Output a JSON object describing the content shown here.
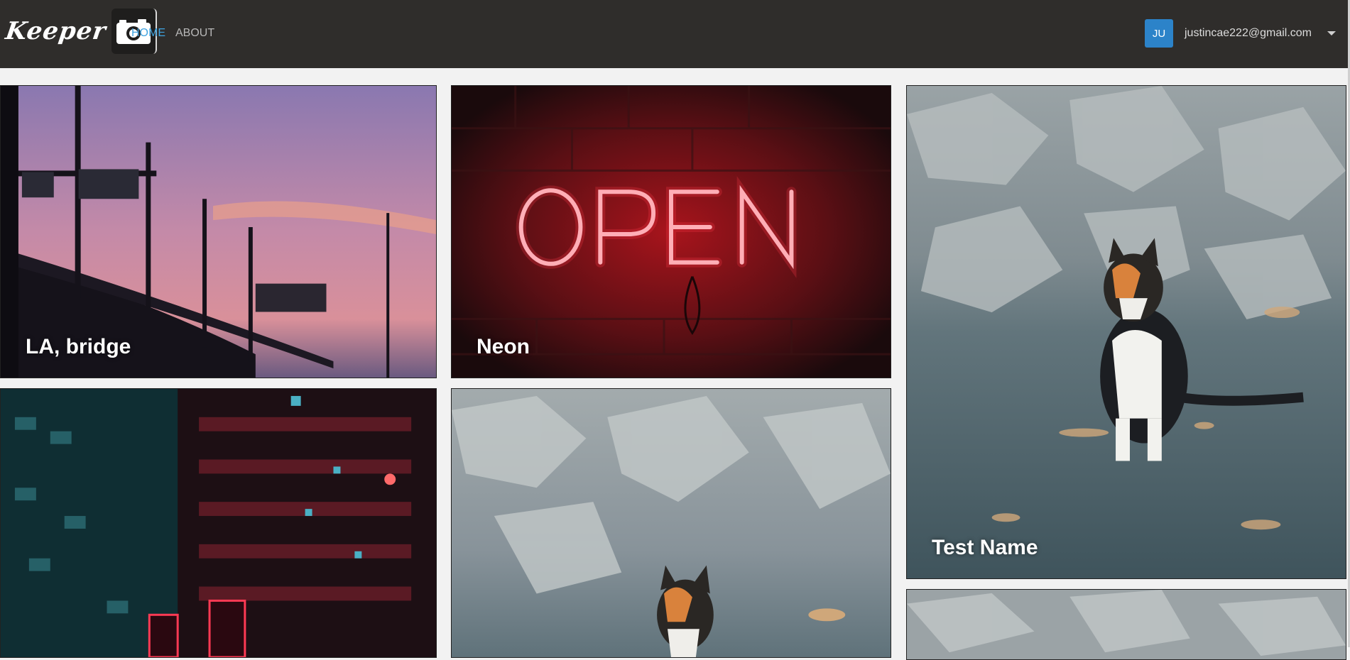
{
  "brand": {
    "name": "Keeper",
    "logo_icon": "camera-icon"
  },
  "nav": {
    "items": [
      {
        "label": "HOME",
        "active": true
      },
      {
        "label": "ABOUT",
        "active": false
      }
    ]
  },
  "user": {
    "initials": "JU",
    "email": "justincae222@gmail.com",
    "dropdown_icon": "caret-down-icon"
  },
  "colors": {
    "navbar": "#2f2d2b",
    "accent": "#3fa3e0",
    "avatar": "#2c83c9"
  },
  "gallery": {
    "items": [
      {
        "title": "LA, bridge"
      },
      {
        "title": "Neon"
      },
      {
        "title": "Test Name"
      },
      {
        "title": ""
      },
      {
        "title": ""
      },
      {
        "title": ""
      }
    ]
  }
}
